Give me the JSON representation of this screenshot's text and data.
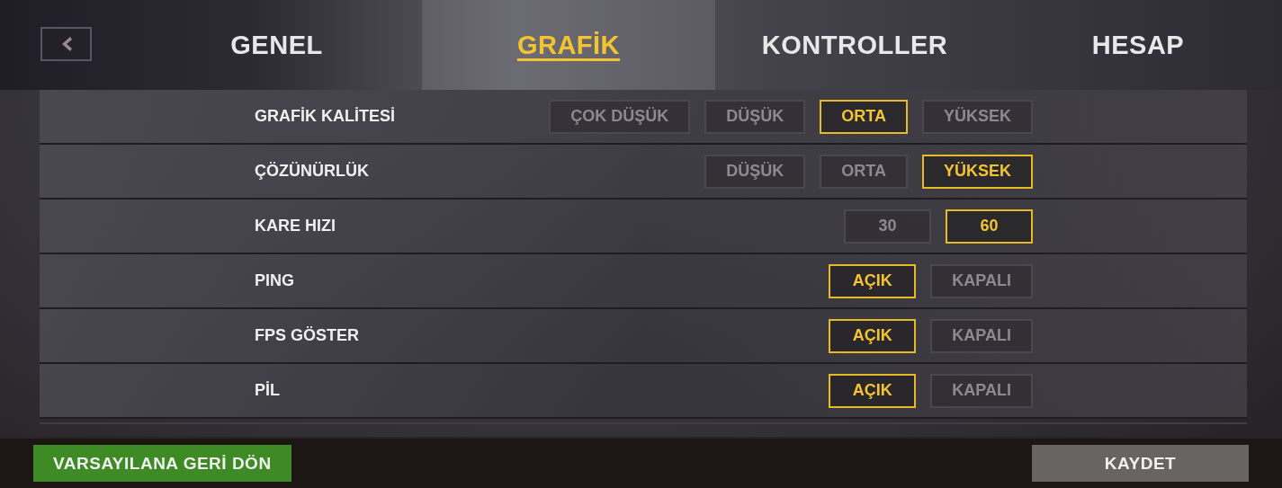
{
  "tabs": [
    {
      "label": "GENEL",
      "selected": false
    },
    {
      "label": "GRAFİK",
      "selected": true
    },
    {
      "label": "KONTROLLER",
      "selected": false
    },
    {
      "label": "HESAP",
      "selected": false
    }
  ],
  "settings": [
    {
      "label": "GRAFİK KALİTESİ",
      "options": [
        {
          "label": "ÇOK DÜŞÜK",
          "selected": false
        },
        {
          "label": "DÜŞÜK",
          "selected": false
        },
        {
          "label": "ORTA",
          "selected": true
        },
        {
          "label": "YÜKSEK",
          "selected": false
        }
      ]
    },
    {
      "label": "ÇÖZÜNÜRLÜK",
      "options": [
        {
          "label": "DÜŞÜK",
          "selected": false
        },
        {
          "label": "ORTA",
          "selected": false
        },
        {
          "label": "YÜKSEK",
          "selected": true
        }
      ]
    },
    {
      "label": "KARE HIZI",
      "options": [
        {
          "label": "30",
          "selected": false
        },
        {
          "label": "60",
          "selected": true
        }
      ]
    },
    {
      "label": "PING",
      "options": [
        {
          "label": "AÇIK",
          "selected": true
        },
        {
          "label": "KAPALI",
          "selected": false
        }
      ]
    },
    {
      "label": "FPS GÖSTER",
      "options": [
        {
          "label": "AÇIK",
          "selected": true
        },
        {
          "label": "KAPALI",
          "selected": false
        }
      ]
    },
    {
      "label": "PİL",
      "options": [
        {
          "label": "AÇIK",
          "selected": true
        },
        {
          "label": "KAPALI",
          "selected": false
        }
      ]
    }
  ],
  "footer": {
    "reset_button": "VARSAYILANA GERİ DÖN",
    "save_button": "KAYDET"
  }
}
